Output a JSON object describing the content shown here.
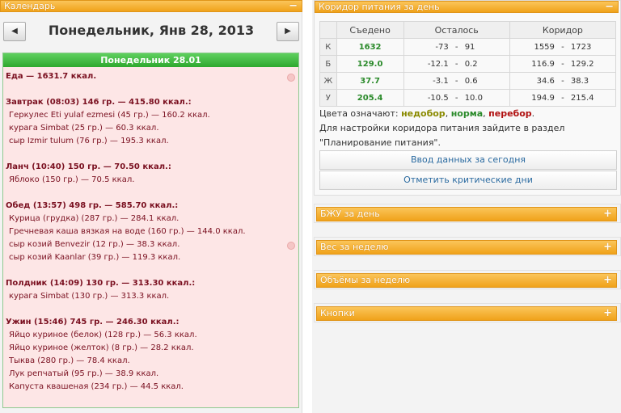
{
  "calendar": {
    "title": "Календарь",
    "collapse_icon": "minus-icon",
    "prev_icon": "triangle-left-icon",
    "next_icon": "triangle-right-icon",
    "date_title": "Понедельник, Янв 28, 2013",
    "day_header": "Понедельник 28.01",
    "lines": [
      {
        "kind": "total",
        "text": "Еда — 1631.7 ккал."
      },
      {
        "kind": "gap",
        "text": ""
      },
      {
        "kind": "meal",
        "text": "Завтрак (08:03) 146 гр. — 415.80 ккал.:"
      },
      {
        "kind": "item",
        "text": "Геркулес Eti yulaf ezmesi (45 гр.) — 160.2 ккал."
      },
      {
        "kind": "item",
        "text": "курага Simbat (25 гр.) — 60.3 ккал."
      },
      {
        "kind": "item",
        "text": "сыр Izmir tulum (76 гр.) — 195.3 ккал."
      },
      {
        "kind": "gap",
        "text": ""
      },
      {
        "kind": "meal",
        "text": "Ланч (10:40) 150 гр. — 70.50 ккал.:"
      },
      {
        "kind": "item",
        "text": "Яблоко (150 гр.) — 70.5 ккал."
      },
      {
        "kind": "gap",
        "text": ""
      },
      {
        "kind": "meal",
        "text": "Обед (13:57) 498 гр. — 585.70 ккал.:"
      },
      {
        "kind": "item",
        "text": "Курица (грудка) (287 гр.) — 284.1 ккал."
      },
      {
        "kind": "item",
        "text": "Гречневая каша вязкая на воде (160 гр.) — 144.0 ккал."
      },
      {
        "kind": "item",
        "text": "сыр козий Benvezir (12 гр.) — 38.3 ккал."
      },
      {
        "kind": "item",
        "text": "сыр козий Kaanlar (39 гр.) — 119.3 ккал."
      },
      {
        "kind": "gap",
        "text": ""
      },
      {
        "kind": "meal",
        "text": "Полдник (14:09) 130 гр. — 313.30 ккал.:"
      },
      {
        "kind": "item",
        "text": "курага Simbat (130 гр.) — 313.3 ккал."
      },
      {
        "kind": "gap",
        "text": ""
      },
      {
        "kind": "meal",
        "text": "Ужин (15:46) 745 гр. — 246.30 ккал.:"
      },
      {
        "kind": "item",
        "text": "Яйцо куриное (белок) (128 гр.) — 56.3 ккал."
      },
      {
        "kind": "item",
        "text": "Яйцо куриное (желток) (8 гр.) — 28.2 ккал."
      },
      {
        "kind": "item",
        "text": "Тыква (280 гр.) — 78.4 ккал."
      },
      {
        "kind": "item",
        "text": "Лук репчатый (95 гр.) — 38.9 ккал."
      },
      {
        "kind": "item",
        "text": "Капуста квашеная (234 гр.) — 44.5 ккал."
      }
    ]
  },
  "corridor": {
    "title": "Коридор питания за день",
    "collapse_icon": "minus-icon",
    "columns": [
      "Съедено",
      "Осталось",
      "Коридор"
    ],
    "rows": [
      {
        "label": "К",
        "eaten": "1632",
        "left_min": "-73",
        "left_max": "91",
        "corr_min": "1559",
        "corr_max": "1723"
      },
      {
        "label": "Б",
        "eaten": "129.0",
        "left_min": "-12.1",
        "left_max": "0.2",
        "corr_min": "116.9",
        "corr_max": "129.2"
      },
      {
        "label": "Ж",
        "eaten": "37.7",
        "left_min": "-3.1",
        "left_max": "0.6",
        "corr_min": "34.6",
        "corr_max": "38.3"
      },
      {
        "label": "У",
        "eaten": "205.4",
        "left_min": "-10.5",
        "left_max": "10.0",
        "corr_min": "194.9",
        "corr_max": "215.4"
      }
    ],
    "dash": "-",
    "legend_prefix": "Цвета означают:",
    "legend_under": "недобор",
    "legend_sep1": ",",
    "legend_norm": "норма",
    "legend_sep2": ",",
    "legend_over": "перебор",
    "legend_end": ".",
    "hint_line1": "Для настройки коридора питания зайдите в раздел",
    "hint_line2": "\"Планирование питания\".",
    "btn_enter": "Ввод данных за сегодня",
    "btn_critical": "Отметить критические дни",
    "colors": {
      "under": "#8a8a00",
      "norm": "#2a8a2a",
      "over": "#b01010"
    }
  },
  "collapsed_panels": [
    {
      "title": "БЖУ за день",
      "icon": "plus-icon"
    },
    {
      "title": "Вес за неделю",
      "icon": "plus-icon"
    },
    {
      "title": "Объёмы за неделю",
      "icon": "plus-icon"
    },
    {
      "title": "Кнопки",
      "icon": "plus-icon"
    }
  ]
}
